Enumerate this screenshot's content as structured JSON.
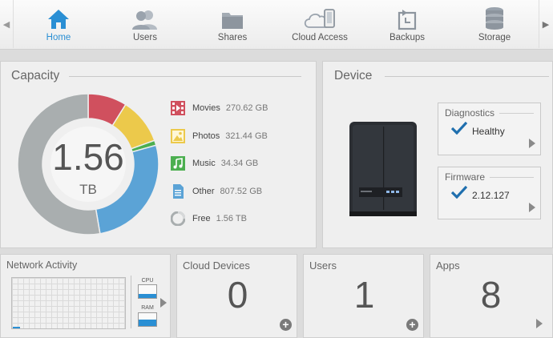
{
  "nav": {
    "items": [
      {
        "label": "Home",
        "icon": "home-icon",
        "active": true
      },
      {
        "label": "Users",
        "icon": "users-icon"
      },
      {
        "label": "Shares",
        "icon": "folder-icon"
      },
      {
        "label": "Cloud Access",
        "icon": "cloud-phone-icon"
      },
      {
        "label": "Backups",
        "icon": "backup-icon"
      },
      {
        "label": "Storage",
        "icon": "database-icon"
      }
    ],
    "left_arrow": "◀",
    "right_arrow": "▶"
  },
  "capacity": {
    "title": "Capacity",
    "total_value": "1.56",
    "total_unit": "TB",
    "legend": [
      {
        "name": "Movies",
        "size": "270.62 GB",
        "color": "#d0505e",
        "icon": "film-icon"
      },
      {
        "name": "Photos",
        "size": "321.44 GB",
        "color": "#ecc94b",
        "icon": "image-icon"
      },
      {
        "name": "Music",
        "size": "34.34 GB",
        "color": "#4caf50",
        "icon": "music-icon"
      },
      {
        "name": "Other",
        "size": "807.52 GB",
        "color": "#5ba3d6",
        "icon": "document-icon"
      },
      {
        "name": "Free",
        "size": "1.56 TB",
        "color": "#a9aeaf",
        "icon": "free-space-icon"
      }
    ]
  },
  "device": {
    "title": "Device",
    "diagnostics": {
      "title": "Diagnostics",
      "value": "Healthy"
    },
    "firmware": {
      "title": "Firmware",
      "value": "2.12.127"
    }
  },
  "network": {
    "title": "Network Activity",
    "cpu_label": "CPU",
    "ram_label": "RAM"
  },
  "cloud_devices": {
    "title": "Cloud Devices",
    "count": "0"
  },
  "users": {
    "title": "Users",
    "count": "1"
  },
  "apps": {
    "title": "Apps",
    "count": "8"
  },
  "colors": {
    "accent": "#2a8fd4",
    "check": "#1f6fae"
  }
}
